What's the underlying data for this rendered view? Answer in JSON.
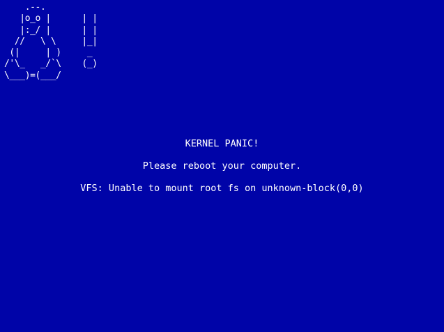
{
  "colors": {
    "background": "#0004a8",
    "text": "#ffffff"
  },
  "ascii_art": {
    "tux_exclamation": "    .--.\n   |o_o |      | |\n   |:_/ |      | |\n  //   \\ \\     |_|\n (|     | )     _\n/'\\_   _/`\\    (_)\n\\___)=(___/"
  },
  "messages": {
    "title": "KERNEL PANIC!",
    "instruction": "Please reboot your computer.",
    "error": "VFS: Unable to mount root fs on unknown-block(0,0)"
  }
}
